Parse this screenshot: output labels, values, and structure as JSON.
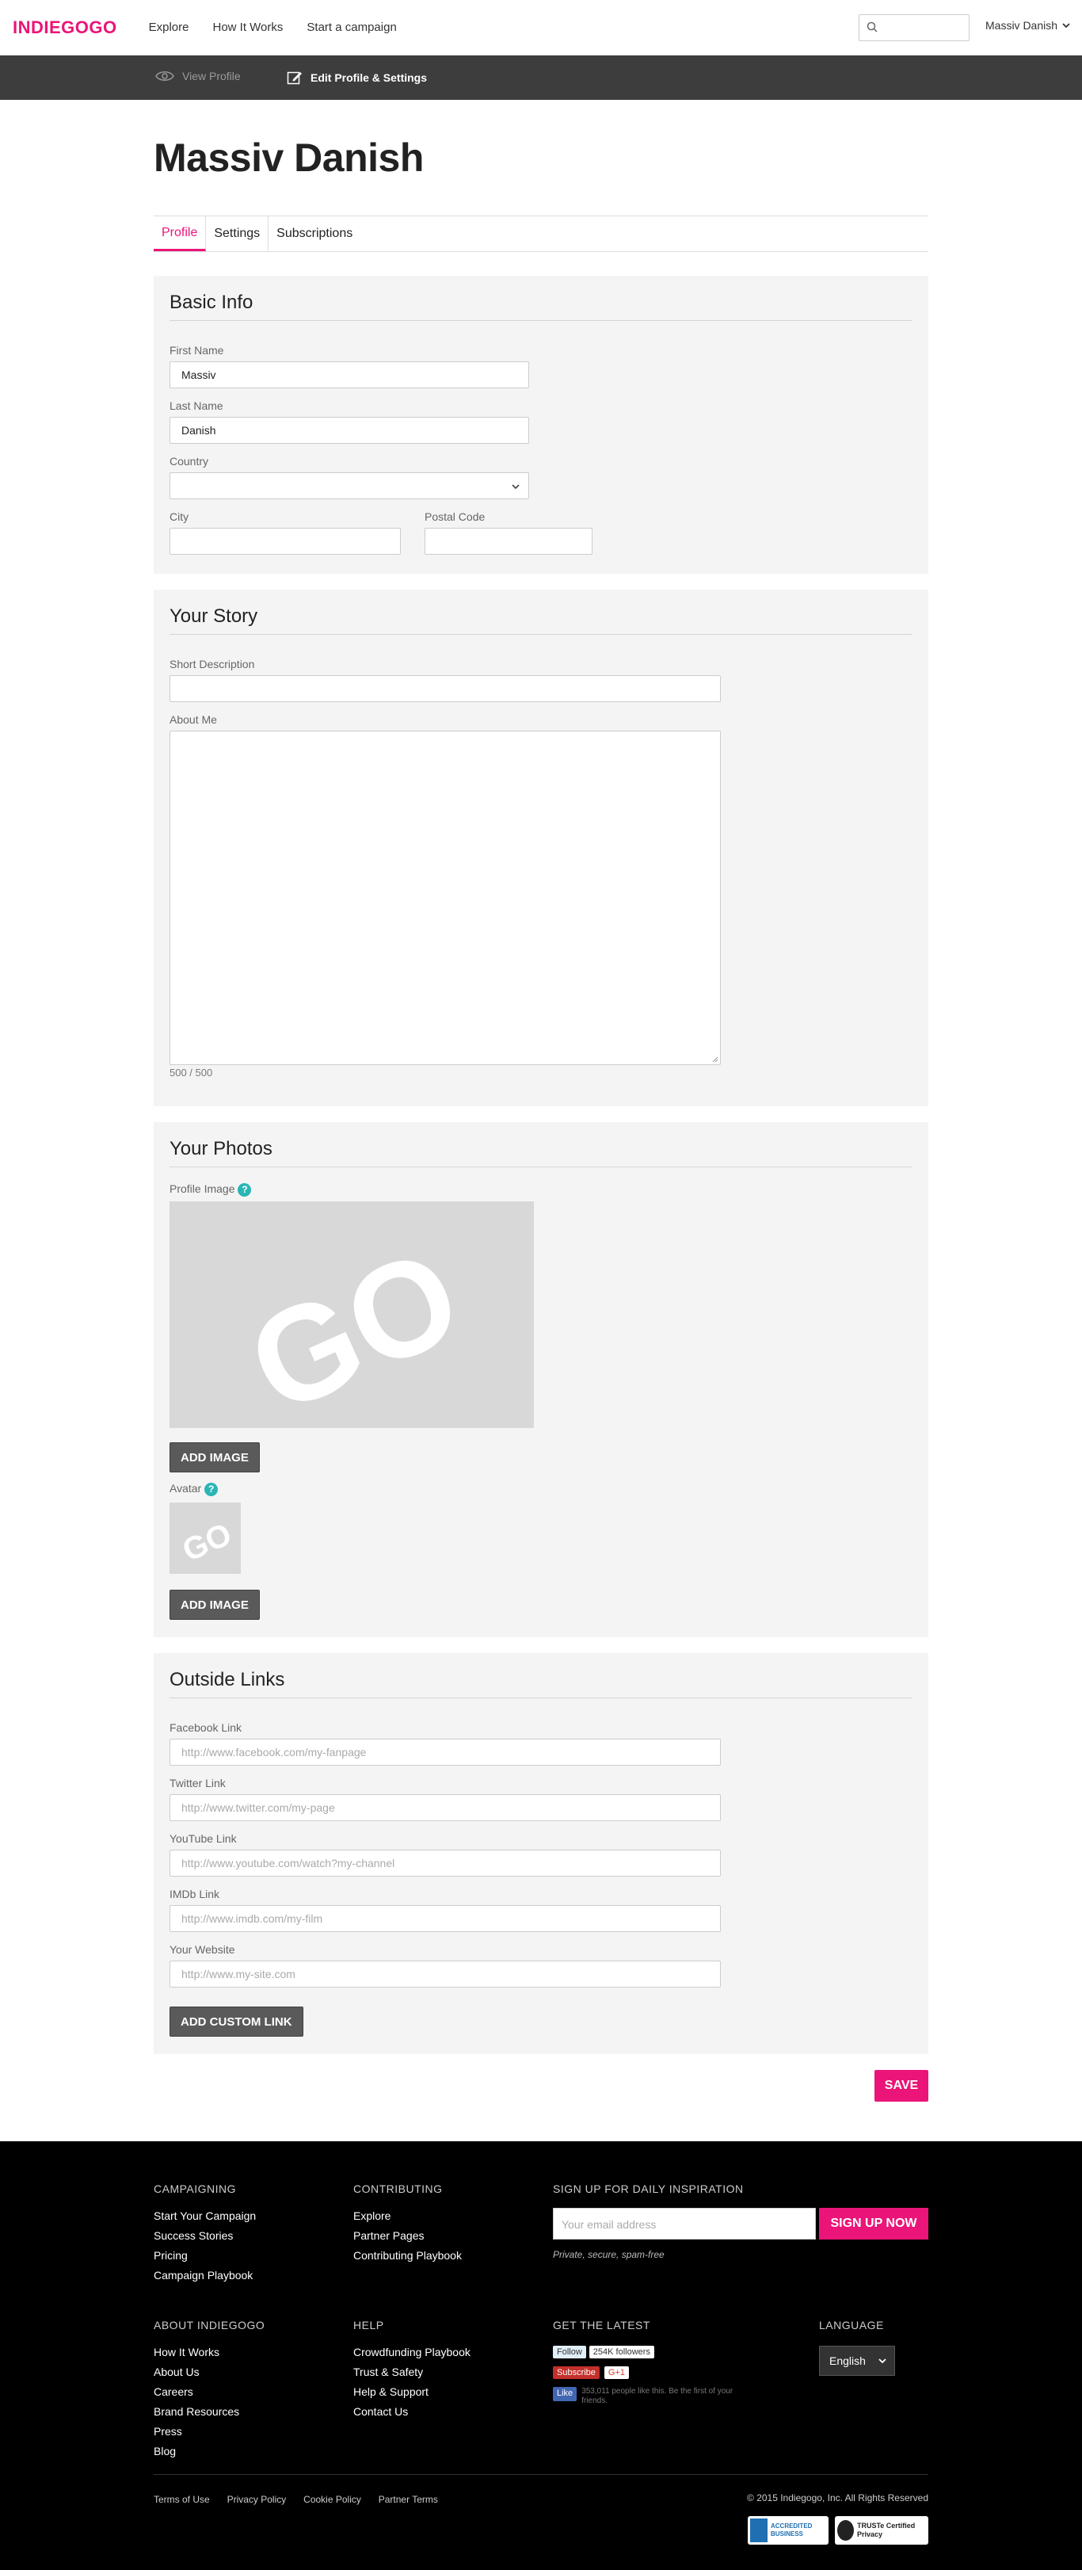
{
  "header": {
    "logo": "INDIEGOGO",
    "nav": [
      "Explore",
      "How It Works",
      "Start a campaign"
    ],
    "search_placeholder": "",
    "user": "Massiv Danish"
  },
  "subbar": {
    "view_profile": "View Profile",
    "edit_profile": "Edit Profile & Settings"
  },
  "page_title": "Massiv Danish",
  "tabs": [
    "Profile",
    "Settings",
    "Subscriptions"
  ],
  "basic_info": {
    "heading": "Basic Info",
    "first_name_label": "First Name",
    "first_name_value": "Massiv",
    "last_name_label": "Last Name",
    "last_name_value": "Danish",
    "country_label": "Country",
    "country_value": "",
    "city_label": "City",
    "city_value": "",
    "postal_label": "Postal Code",
    "postal_value": ""
  },
  "story": {
    "heading": "Your Story",
    "short_desc_label": "Short Description",
    "about_label": "About Me",
    "counter": "500 / 500"
  },
  "photos": {
    "heading": "Your Photos",
    "profile_image_label": "Profile Image",
    "avatar_label": "Avatar",
    "add_image": "ADD IMAGE",
    "placeholder_logo": "GO"
  },
  "links": {
    "heading": "Outside Links",
    "fields": [
      {
        "label": "Facebook Link",
        "placeholder": "http://www.facebook.com/my-fanpage"
      },
      {
        "label": "Twitter Link",
        "placeholder": "http://www.twitter.com/my-page"
      },
      {
        "label": "YouTube Link",
        "placeholder": "http://www.youtube.com/watch?my-channel"
      },
      {
        "label": "IMDb Link",
        "placeholder": "http://www.imdb.com/my-film"
      },
      {
        "label": "Your Website",
        "placeholder": "http://www.my-site.com"
      }
    ],
    "add_custom": "ADD CUSTOM LINK"
  },
  "save": "SAVE",
  "footer": {
    "campaigning": {
      "heading": "CAMPAIGNING",
      "links": [
        "Start Your Campaign",
        "Success Stories",
        "Pricing",
        "Campaign Playbook"
      ]
    },
    "contributing": {
      "heading": "CONTRIBUTING",
      "links": [
        "Explore",
        "Partner Pages",
        "Contributing Playbook"
      ]
    },
    "signup": {
      "heading": "SIGN UP FOR DAILY INSPIRATION",
      "placeholder": "Your email address",
      "button": "SIGN UP NOW",
      "note": "Private, secure, spam-free"
    },
    "about": {
      "heading": "ABOUT INDIEGOGO",
      "links": [
        "How It Works",
        "About Us",
        "Careers",
        "Brand Resources",
        "Press",
        "Blog"
      ]
    },
    "help": {
      "heading": "HELP",
      "links": [
        "Crowdfunding Playbook",
        "Trust & Safety",
        "Help & Support",
        "Contact Us"
      ]
    },
    "latest": {
      "heading": "GET THE LATEST",
      "follow": "Follow",
      "followers": "254K followers",
      "youtube": "Subscribe",
      "gplus": "G+1",
      "fb_like": "Like",
      "fb_text": "353,011 people like this. Be the first of your friends."
    },
    "language": {
      "heading": "LANGUAGE",
      "value": "English"
    },
    "bottom_links": [
      "Terms of Use",
      "Privacy Policy",
      "Cookie Policy",
      "Partner Terms"
    ],
    "copyright": "© 2015 Indiegogo, Inc. All Rights Reserved",
    "badge_bbb": "ACCREDITED BUSINESS",
    "badge_truste": "TRUSTe Certified Privacy"
  },
  "colors": {
    "brand": "#eb1478",
    "subbar": "#3d3d3d",
    "panel": "#f4f4f4",
    "help": "#2ab5b5"
  }
}
